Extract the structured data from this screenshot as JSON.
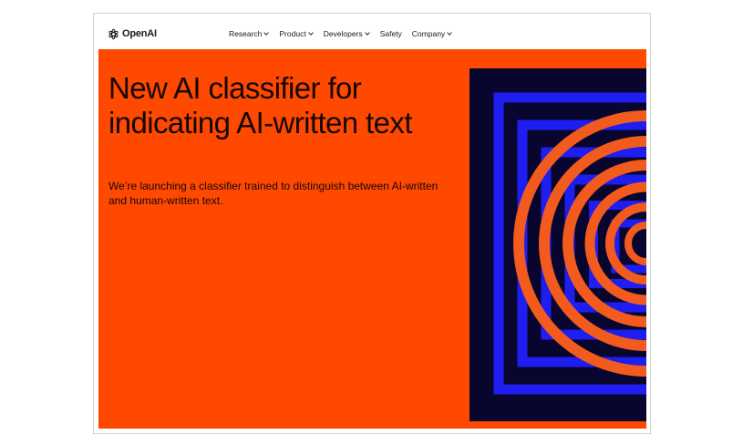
{
  "header": {
    "logo_text": "OpenAI",
    "nav": [
      {
        "label": "Research",
        "has_dropdown": true
      },
      {
        "label": "Product",
        "has_dropdown": true
      },
      {
        "label": "Developers",
        "has_dropdown": true
      },
      {
        "label": "Safety",
        "has_dropdown": false
      },
      {
        "label": "Company",
        "has_dropdown": true
      }
    ]
  },
  "hero": {
    "title": "New AI classifier for indicating AI-written text",
    "subtitle": "We’re launching a classifier trained to distinguish between AI-written and human-written text."
  },
  "colors": {
    "hero_background": "#ff4800",
    "text": "#14080a",
    "art_navy": "#08062e",
    "art_blue": "#1e1ef0",
    "art_orange": "#f25a1e"
  },
  "icons": {
    "logo": "openai-logo-icon",
    "dropdown": "chevron-down-icon"
  }
}
